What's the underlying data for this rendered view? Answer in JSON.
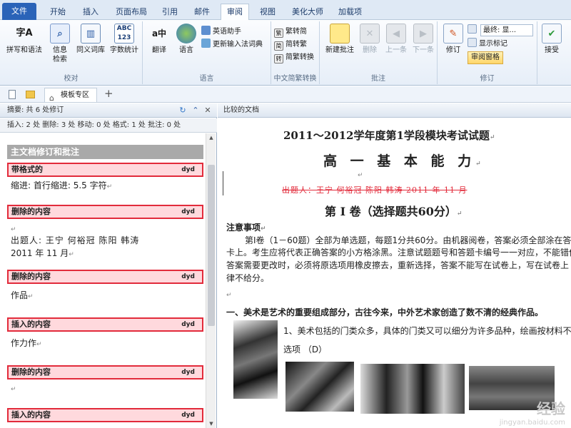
{
  "tabs": [
    "文件",
    "开始",
    "插入",
    "页面布局",
    "引用",
    "邮件",
    "审阅",
    "视图",
    "美化大师",
    "加载项"
  ],
  "ribbon": {
    "proofing": {
      "label": "校对",
      "buttons": [
        "拼写和语法",
        "信息\n检索",
        "同义词库",
        "字数统计"
      ]
    },
    "translate": {
      "translate_btn": "翻译",
      "language_btn": "语言"
    },
    "language": {
      "label": "语言",
      "items": [
        "英语助手",
        "更新输入法词典"
      ]
    },
    "chinese": {
      "label": "中文简繁转换",
      "items": [
        "繁转简",
        "简转繁",
        "简繁转换"
      ]
    },
    "comments": {
      "label": "批注",
      "buttons": [
        "新建批注",
        "删除",
        "上一条",
        "下一条"
      ]
    },
    "tracking": {
      "label": "修订",
      "revise": "修订",
      "final_dropdown": "最终: 显...",
      "show_markup": "显示标记",
      "reviewing_pane": "审阅窗格"
    },
    "accept": "接受"
  },
  "doc_tabs": {
    "template_tab": "模板专区",
    "add": "+"
  },
  "pane": {
    "summary": "摘要: 共 6 处修订",
    "stats": "插入: 2 处   删除: 3 处   移动: 0 处   格式: 1 处   批注: 0 处",
    "main_title": "主文档修订和批注",
    "revisions": [
      {
        "type": "带格式的",
        "author": "dyd",
        "lines": [
          "缩进: 首行缩进:  5.5 字符"
        ]
      },
      {
        "type": "删除的内容",
        "author": "dyd",
        "lines": [
          "出题人: 王宁   何裕冠   陈阳  韩涛",
          "2011 年 11 月"
        ]
      },
      {
        "type": "删除的内容",
        "author": "dyd",
        "lines": [
          "作品"
        ]
      },
      {
        "type": "插入的内容",
        "author": "dyd",
        "lines": [
          "作力作"
        ]
      },
      {
        "type": "删除的内容",
        "author": "dyd",
        "lines": [
          ""
        ]
      },
      {
        "type": "插入的内容",
        "author": "dyd",
        "lines": []
      }
    ]
  },
  "doc": {
    "header": "比较的文档",
    "title": "2011～2012学年度第1学段模块考试试题",
    "subtitle": "高 一 基 本 能 力",
    "deleted_line": "出题人：王宁   何裕冠   陈阳  韩涛        2011 年 11 月",
    "section1": "第 Ⅰ 卷（选择题共60分）",
    "notice_title": "注意事项",
    "notice_lines": [
      "第Ⅰ卷（1－60题）全部为单选题，每题1分共60分。由机器阅卷，答案必须全部涂在答",
      "卡上。考生应将代表正确答案的小方格涂黑。注意试题题号和答题卡编号一一对应，不能错位",
      "答案需要更改时，必须将原选项用橡皮擦去，重新选择，答案不能写在试卷上，写在试卷上",
      "律不给分。"
    ],
    "q_heading": "一、美术是艺术的重要组成部分，古往今来，中外艺术家创造了数不清的经典作品。",
    "q1": "1、美术包括的门类众多，具体的门类又可以细分为许多品种，绘画按材料不",
    "q1_option": "选项          （D）",
    "watermark": "经验",
    "watermark_url": "jingyan.baidu.com"
  }
}
